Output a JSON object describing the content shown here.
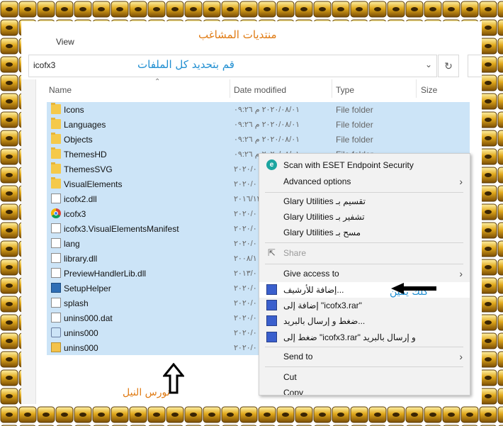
{
  "menubar": {
    "view_label": "View"
  },
  "overlay": {
    "site_title": "منتديات المشاغب",
    "instruction": "قم بتحديد كل الملفات",
    "right_click_note": "كلك يمين",
    "signature": "نورس النيل"
  },
  "address": {
    "path": "icofx3"
  },
  "columns": {
    "name": "Name",
    "date": "Date modified",
    "type": "Type",
    "size": "Size"
  },
  "files": [
    {
      "name": "Icons",
      "date": "٢٠٢٠/٠٨/٠١ م ٠٩:٢٦",
      "type": "File folder",
      "icon": "folder-icon"
    },
    {
      "name": "Languages",
      "date": "٢٠٢٠/٠٨/٠١ م ٠٩:٢٦",
      "type": "File folder",
      "icon": "folder-icon"
    },
    {
      "name": "Objects",
      "date": "٢٠٢٠/٠٨/٠١ م ٠٩:٢٦",
      "type": "File folder",
      "icon": "folder-icon"
    },
    {
      "name": "ThemesHD",
      "date": "٢٠٢٠/٠٨/٠١ م ٠٩:٢٦",
      "type": "File folder",
      "icon": "folder-icon"
    },
    {
      "name": "ThemesSVG",
      "date": "٢٠٢٠/٠",
      "type": "",
      "icon": "folder-icon"
    },
    {
      "name": "VisualElements",
      "date": "٢٠٢٠/٠",
      "type": "",
      "icon": "folder-icon"
    },
    {
      "name": "icofx2.dll",
      "date": "٢٠١٦/١٢",
      "type": "",
      "icon": "file-icon"
    },
    {
      "name": "icofx3",
      "date": "٢٠٢٠/٠",
      "type": "",
      "icon": "chrome-icon"
    },
    {
      "name": "icofx3.VisualElementsManifest",
      "date": "٢٠٢٠/٠",
      "type": "",
      "icon": "file-icon"
    },
    {
      "name": "lang",
      "date": "٢٠٢٠/٠",
      "type": "",
      "icon": "file-icon"
    },
    {
      "name": "library.dll",
      "date": "٢٠٠٨/١",
      "type": "",
      "icon": "file-icon"
    },
    {
      "name": "PreviewHandlerLib.dll",
      "date": "٢٠١٣/٠",
      "type": "",
      "icon": "file-icon"
    },
    {
      "name": "SetupHelper",
      "date": "٢٠٢٠/٠",
      "type": "",
      "icon": "setup-icon"
    },
    {
      "name": "splash",
      "date": "٢٠٢٠/٠",
      "type": "",
      "icon": "file-icon"
    },
    {
      "name": "unins000.dat",
      "date": "٢٠٢٠/٠",
      "type": "",
      "icon": "file-icon"
    },
    {
      "name": "unins000",
      "date": "٢٠٢٠/٠",
      "type": "",
      "icon": "down-icon"
    },
    {
      "name": "unins000",
      "date": "٢٠٢٠/٠",
      "type": "",
      "icon": "mail-icon"
    }
  ],
  "context_menu": {
    "scan": "Scan with ESET Endpoint Security",
    "advanced": "Advanced options",
    "glary_split": "Glary Utilities تقسيم بـ",
    "glary_encrypt": "Glary Utilities تشفير بـ",
    "glary_wipe": "Glary Utilities مسح بـ",
    "share": "Share",
    "give_access": "Give access to",
    "add_archive": "إضافة للأرشيف...",
    "add_rar": "إضافة إلى \"icofx3.rar\"",
    "compress_email": "ضغط و إرسال بالبريد...",
    "compress_rar_email": "ضغط إلى \"icofx3.rar\" و إرسال بالبريد",
    "send_to": "Send to",
    "cut": "Cut",
    "copy": "Copy"
  }
}
